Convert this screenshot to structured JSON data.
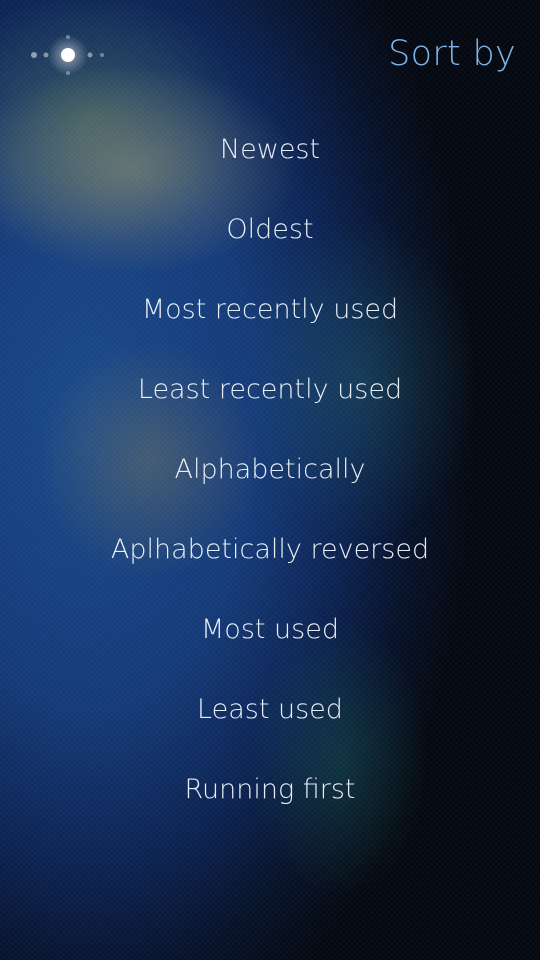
{
  "header": {
    "title": "Sort by",
    "title_color": "#7fb4ea"
  },
  "status": {
    "busy_indicator_icon": "sparkle-busy-icon"
  },
  "menu": {
    "items": [
      {
        "label": "Newest"
      },
      {
        "label": "Oldest"
      },
      {
        "label": "Most recently used"
      },
      {
        "label": "Least recently used"
      },
      {
        "label": "Alphabetically"
      },
      {
        "label": "Aplhabetically reversed"
      },
      {
        "label": "Most used"
      },
      {
        "label": "Least used"
      },
      {
        "label": "Running first"
      }
    ]
  }
}
